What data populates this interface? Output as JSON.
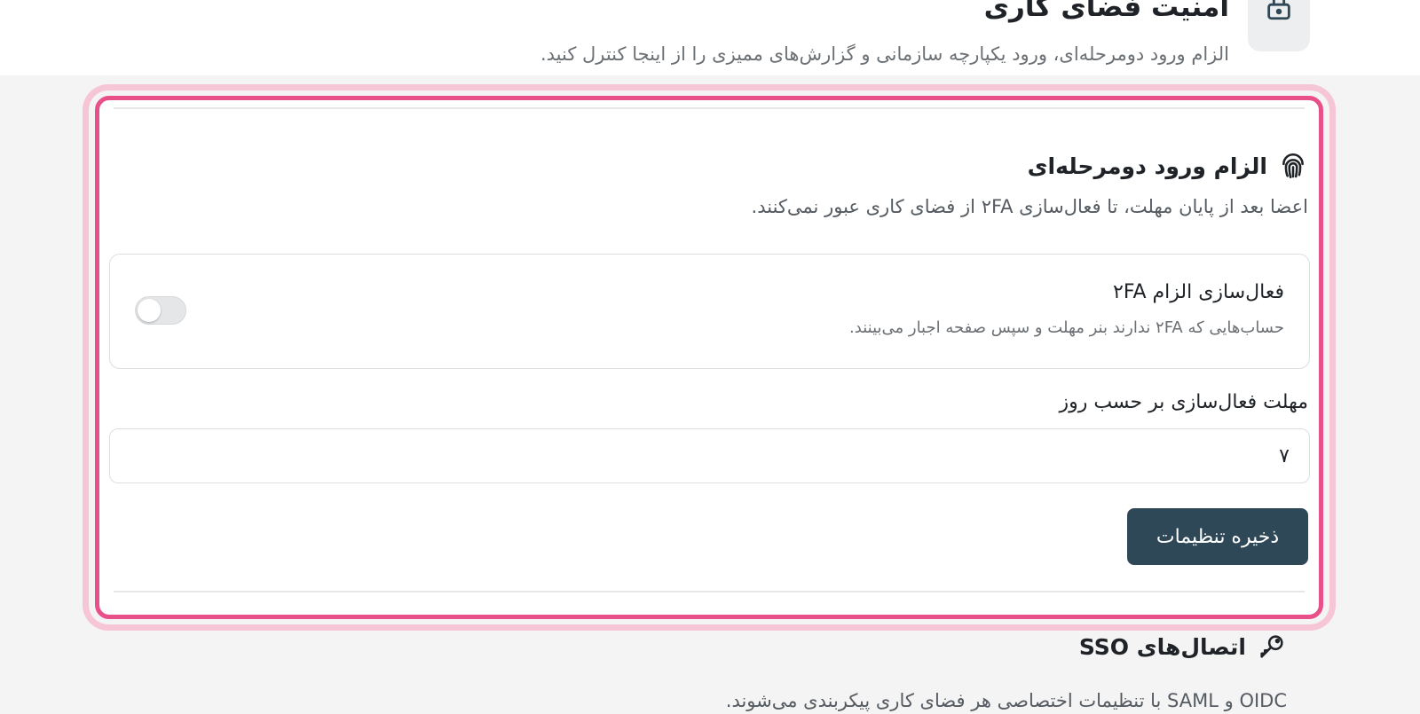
{
  "header": {
    "title": "امنیت فضای کاری",
    "subtitle": "الزام ورود دومرحله‌ای، ورود یکپارچه سازمانی و گزارش‌های ممیزی را از اینجا کنترل کنید.",
    "icon": "lock-icon"
  },
  "two_factor": {
    "icon": "fingerprint-icon",
    "title": "الزام ورود دومرحله‌ای",
    "description": "اعضا بعد از پایان مهلت، تا فعال‌سازی ۲FA از فضای کاری عبور نمی‌کنند.",
    "toggle": {
      "title": "فعال‌سازی الزام ۲FA",
      "description": "حساب‌هایی که ۲FA ندارند بنر مهلت و سپس صفحه اجبار می‌بینند.",
      "enabled": false
    },
    "grace_period": {
      "label": "مهلت فعال‌سازی بر حسب روز",
      "value": "۷"
    },
    "save_label": "ذخیره تنظیمات"
  },
  "sso": {
    "icon": "key-icon",
    "title": "اتصال‌های SSO",
    "description": "OIDC و SAML با تنظیمات اختصاصی هر فضای کاری پیکربندی می‌شوند."
  },
  "colors": {
    "accent_highlight": "#e8508a",
    "button": "#2f4858",
    "background": "#f4f4f4"
  }
}
